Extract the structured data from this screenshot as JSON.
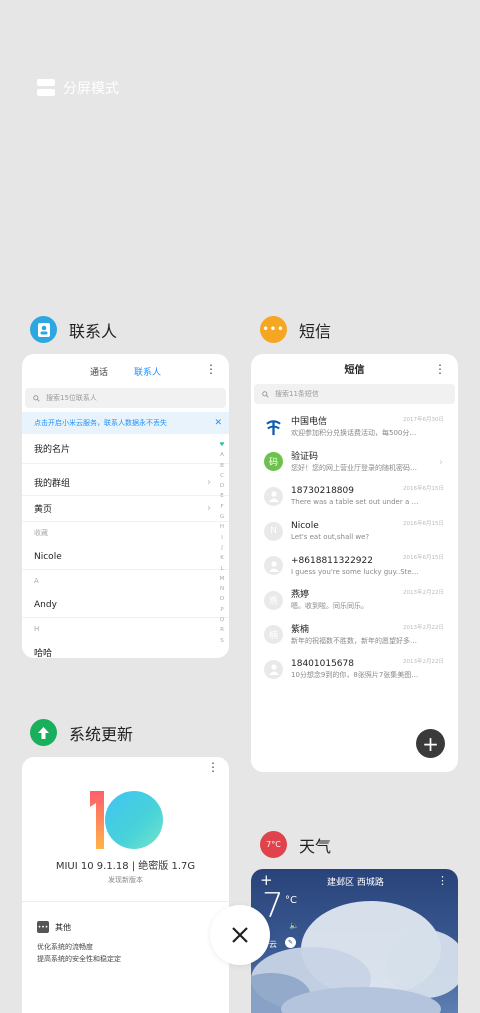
{
  "split_screen": {
    "label": "分屏模式",
    "icon": "split-screen-icon"
  },
  "contacts_app": {
    "title": "联系人",
    "icon_color": "#2ea7e0",
    "tabs": [
      "通话",
      "联系人"
    ],
    "search_placeholder": "搜索15位联系人",
    "banner": "点击开启小米云服务，联系人数据永不丢失",
    "rows": {
      "my_card": "我的名片",
      "my_groups": "我的群组",
      "yellow_pages": "黄页"
    },
    "sections": {
      "favorites": "收藏",
      "a": "A",
      "h": "H"
    },
    "contacts": {
      "nicole": "Nicole",
      "andy": "Andy",
      "haha": "哈哈"
    },
    "alphabet": [
      "♥",
      "A",
      "B",
      "C",
      "D",
      "E",
      "F",
      "G",
      "H",
      "I",
      "J",
      "K",
      "L",
      "M",
      "N",
      "O",
      "P",
      "Q",
      "R",
      "S"
    ]
  },
  "sms_app": {
    "title": "短信",
    "icon_color": "#f5a623",
    "header": "短信",
    "search_placeholder": "搜索11条短信",
    "messages": [
      {
        "name": "中国电信",
        "preview": "欢迎参加积分兑换话费活动，每500分可...",
        "date": "2017年6月30日",
        "avatar": "telecom-logo-icon",
        "avatar_text": ""
      },
      {
        "name": "验证码",
        "preview": "您好！您的网上营业厅登录的随机密码为...",
        "date": "",
        "avatar": "verification-code-icon",
        "avatar_text": "码"
      },
      {
        "name": "18730218809",
        "preview": "There was a table set out under a tree i...",
        "date": "2016年6月15日",
        "avatar": "person-icon",
        "avatar_text": ""
      },
      {
        "name": "Nicole",
        "preview": "Let's eat out,shall we?",
        "date": "2016年6月15日",
        "avatar": "letter-avatar",
        "avatar_text": "N"
      },
      {
        "name": "+8618811322922",
        "preview": "I guess you're some lucky guy..Stepha...",
        "date": "2016年6月15日",
        "avatar": "person-icon",
        "avatar_text": ""
      },
      {
        "name": "燕婷",
        "preview": "嗯。收到啦。同乐同乐。",
        "date": "2013年2月22日",
        "avatar": "letter-avatar",
        "avatar_text": "燕"
      },
      {
        "name": "紫楠",
        "preview": "新年的祝福数不胜数，新年的愿望好多好多...",
        "date": "2013年2月22日",
        "avatar": "letter-avatar",
        "avatar_text": "楠"
      },
      {
        "name": "18401015678",
        "preview": "10分想念9到的你，8张照片7张集美图，6只...",
        "date": "2013年2月22日",
        "avatar": "person-icon",
        "avatar_text": ""
      }
    ],
    "fab": "+"
  },
  "update_app": {
    "title": "系统更新",
    "icon_color": "#1aaf5d",
    "version": "MIUI 10 9.1.18 | 绝密版 1.7G",
    "subtitle": "发现新版本",
    "section_title": "其他",
    "lines": [
      "优化系统的流畅度",
      "提高系统的安全性和稳定定"
    ]
  },
  "weather_app": {
    "title": "天气",
    "icon_text": "7°C",
    "icon_color": "#e0434b",
    "location": "建邺区 西城路",
    "temperature": "7",
    "unit": "°C",
    "condition": "云"
  },
  "close_button": {
    "icon": "close-icon"
  }
}
